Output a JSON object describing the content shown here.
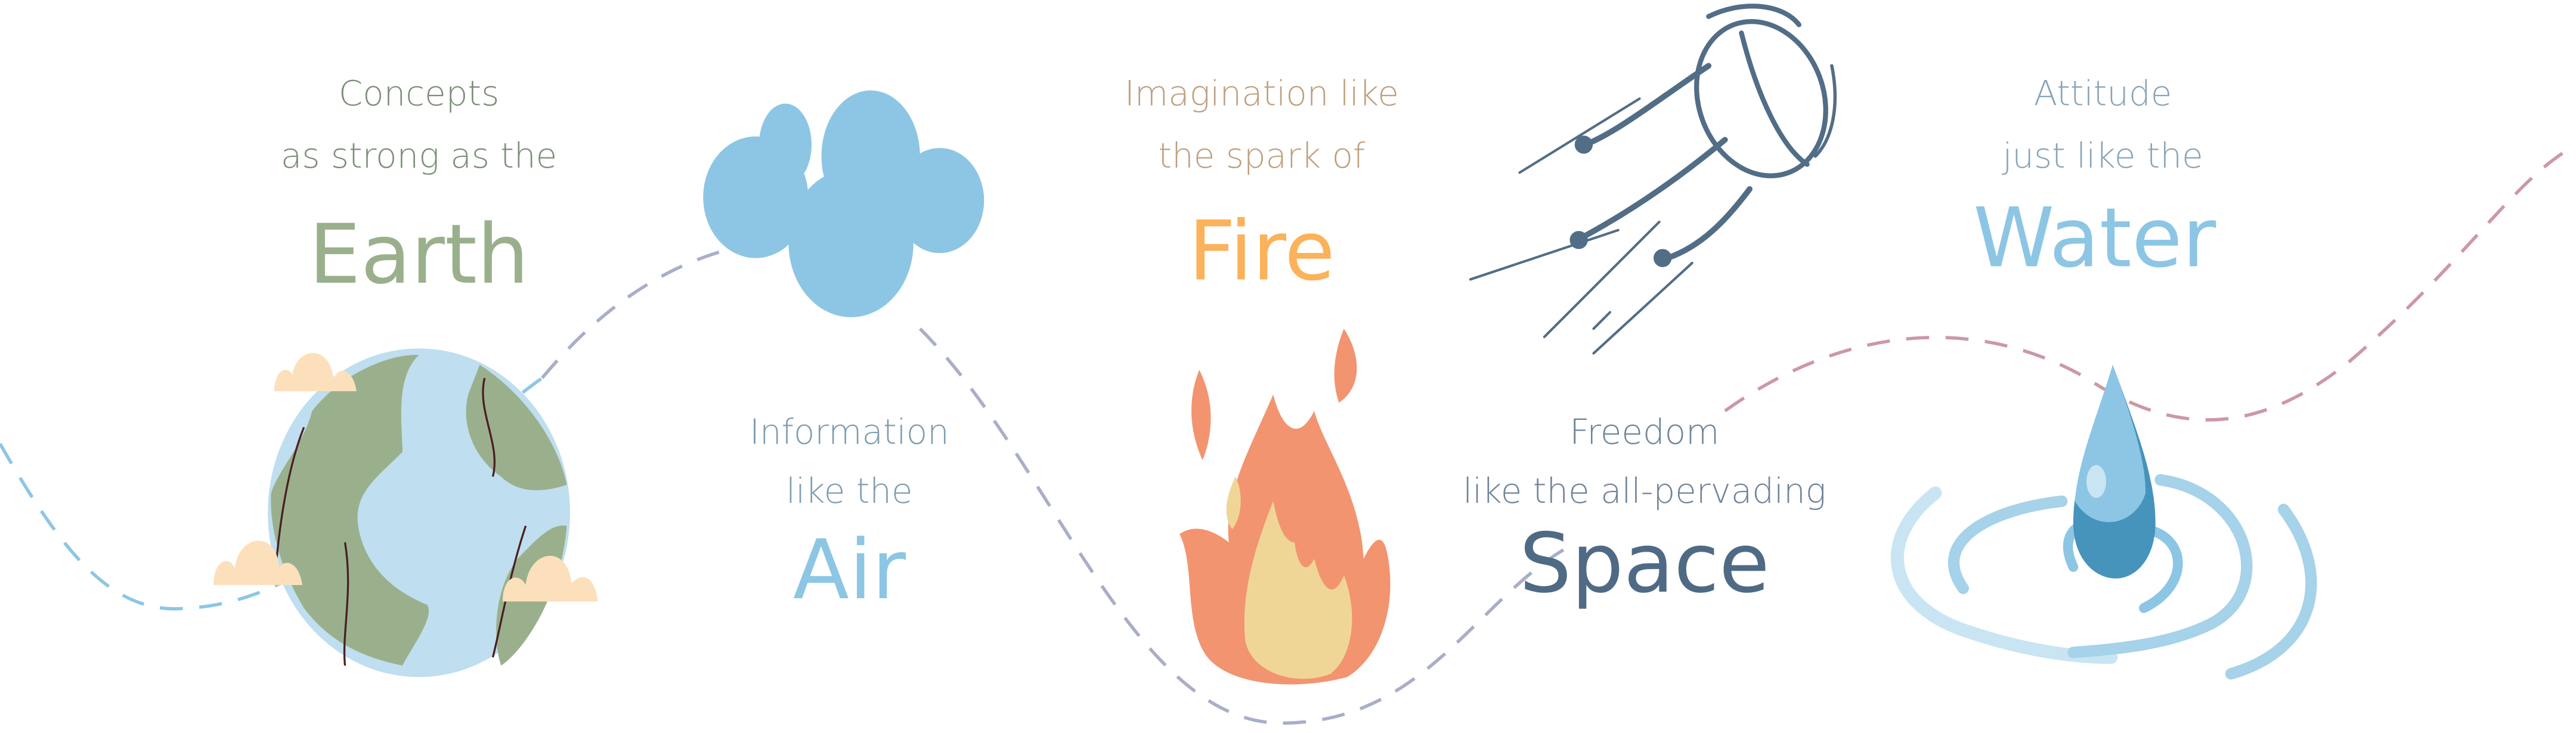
{
  "colors": {
    "earth_caption": "#7b8f78",
    "earth_word": "#9ab08c",
    "air_caption": "#7f9db0",
    "air_word": "#8cc6e4",
    "fire_caption": "#bfa07f",
    "fire_word": "#fbb25a",
    "space_caption": "#6f849a",
    "space_word": "#4f6a85",
    "water_caption": "#8aa4b8",
    "water_word": "#8cc6e4",
    "path_blue": "#8cc6e4",
    "path_lilac": "#a9aec8",
    "path_pink": "#cc98a6"
  },
  "elements": [
    {
      "key": "earth",
      "line1": "Concepts",
      "line2": "as strong as the",
      "word": "Earth",
      "icon": "globe-icon"
    },
    {
      "key": "air",
      "line1": "Information",
      "line2": "like the",
      "word": "Air",
      "icon": "cloud-icon"
    },
    {
      "key": "fire",
      "line1": "Imagination like",
      "line2": "the spark of",
      "word": "Fire",
      "icon": "flame-icon"
    },
    {
      "key": "space",
      "line1": "Freedom",
      "line2": "like the all-pervading",
      "word": "Space",
      "icon": "satellite-icon"
    },
    {
      "key": "water",
      "line1": "Attitude",
      "line2": "just like the",
      "word": "Water",
      "icon": "water-drop-icon"
    }
  ]
}
